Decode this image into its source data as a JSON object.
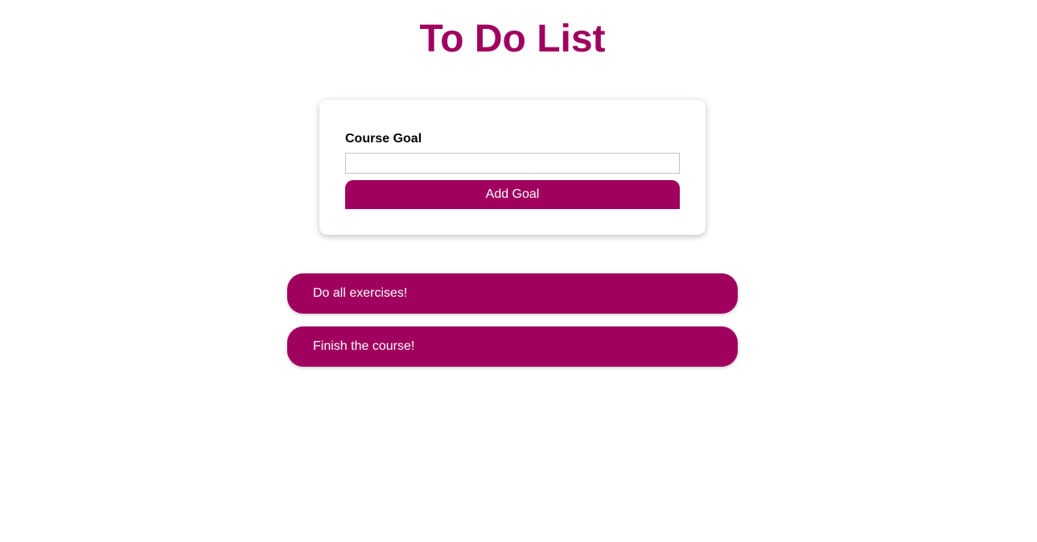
{
  "page": {
    "title": "To Do List"
  },
  "form": {
    "label": "Course Goal",
    "input_value": "",
    "button_label": "Add Goal"
  },
  "goals": [
    {
      "text": "Do all exercises!"
    },
    {
      "text": "Finish the course!"
    }
  ],
  "colors": {
    "accent": "#a0005e",
    "background": "#ffffff",
    "input_border": "#c4c4c4"
  }
}
